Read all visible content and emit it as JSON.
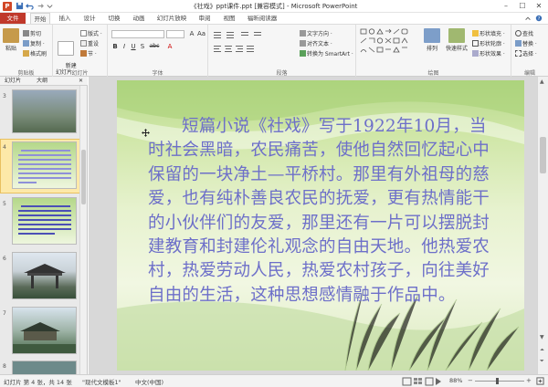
{
  "window": {
    "title": "《社戏》ppt课件.ppt [兼容模式] - Microsoft PowerPoint",
    "app_letter": "P"
  },
  "tabs": [
    "文件",
    "开始",
    "插入",
    "设计",
    "切换",
    "动画",
    "幻灯片放映",
    "审阅",
    "视图",
    "福昕阅读器"
  ],
  "ribbon": {
    "clipboard": {
      "paste": "粘贴",
      "cut": "剪切",
      "copy": "复制 ·",
      "format_painter": "格式刷",
      "label": "剪贴板"
    },
    "slides": {
      "new_slide": "新建\n幻灯片 ·",
      "layout": "版式 ·",
      "reset": "重设",
      "section": "节 ·",
      "label": "幻灯片"
    },
    "font": {
      "label": "字体",
      "font_placeholder": "",
      "size_value": "",
      "buttons": [
        "B",
        "I",
        "U",
        "S",
        "abc",
        "A",
        "Aa",
        "A"
      ]
    },
    "paragraph": {
      "text_direction": "文字方向 ·",
      "align_text": "对齐文本 ·",
      "smartart": "转换为 SmartArt ·",
      "label": "段落"
    },
    "drawing": {
      "arrange": "排列",
      "quick_styles": "快速样式",
      "shape_fill": "形状填充 ·",
      "shape_outline": "形状轮廓 ·",
      "shape_effects": "形状效果 ·",
      "label": "绘图"
    },
    "editing": {
      "find": "查找",
      "replace": "替换 ·",
      "select": "选择 ·",
      "label": "编辑"
    }
  },
  "pane": {
    "tab_slides": "幻灯片",
    "tab_outline": "大纲",
    "thumb_numbers": [
      "3",
      "4",
      "5",
      "6",
      "7",
      "8"
    ]
  },
  "slide": {
    "body_text": "短篇小说《社戏》写于1922年10月，当时社会黑暗，农民痛苦，使他自然回忆起心中保留的一块净土—平桥村。那里有外祖母的慈爱，也有纯朴善良农民的抚爱，更有热情能干的小伙伴们的友爱，那里还有一片可以摆脱封建教育和封建伦礼观念的自由天地。他热爱农村，热爱劳动人民，热爱农村孩子，向往美好自由的生活，这种思想感情融于作品中。"
  },
  "status": {
    "slide_info": "幻灯片 第 4 张，共 14 张",
    "theme": "\"现代文模板1\"",
    "language": "中文(中国)",
    "zoom": "88%"
  },
  "colors": {
    "file_tab": "#c0392b",
    "slide_text": "#6d6fc9",
    "accent": "#d24726"
  }
}
